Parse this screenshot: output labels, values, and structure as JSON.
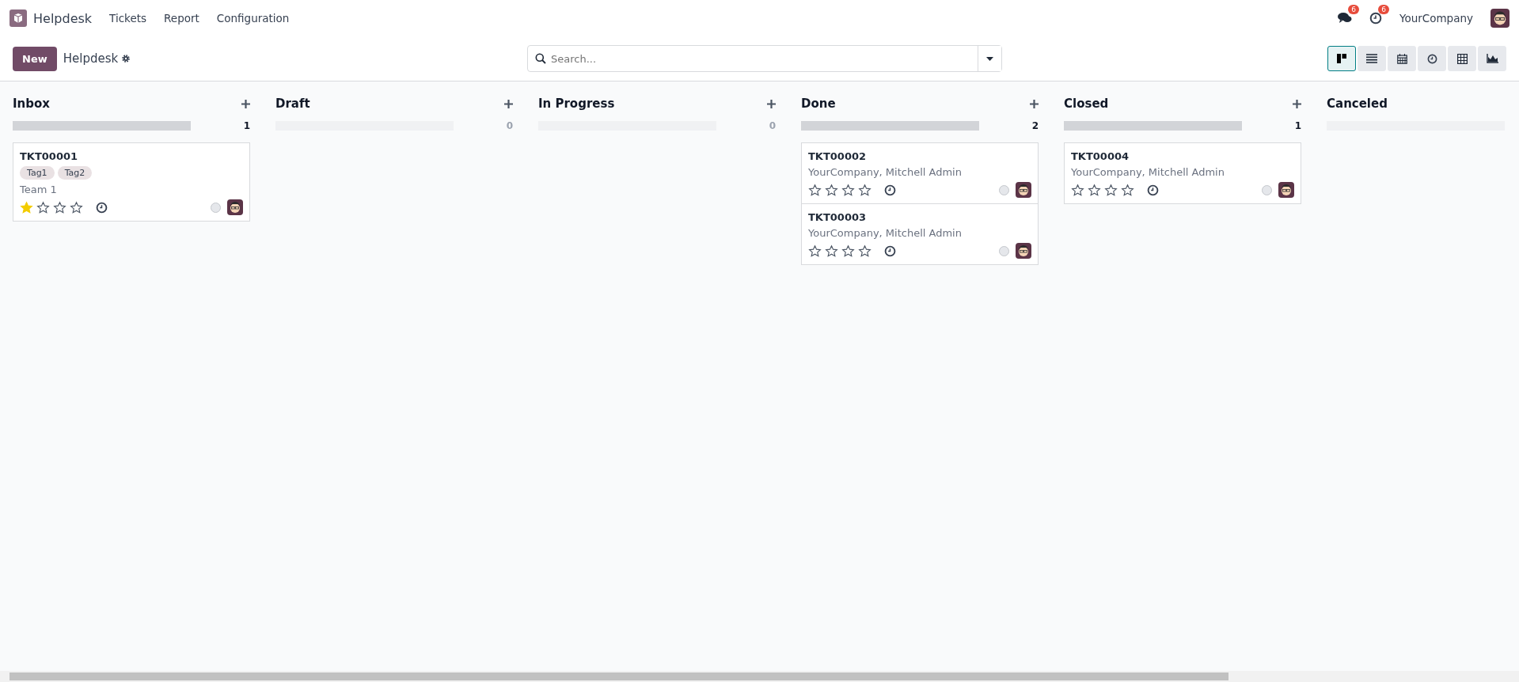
{
  "navbar": {
    "app_name": "Helpdesk",
    "menus": [
      "Tickets",
      "Report",
      "Configuration"
    ],
    "messages_badge": "6",
    "activities_badge": "6",
    "company": "YourCompany"
  },
  "control_panel": {
    "new_button": "New",
    "breadcrumb": "Helpdesk",
    "search": {
      "placeholder": "Search..."
    },
    "views": [
      {
        "kind": "kanban",
        "selected": true
      },
      {
        "kind": "list",
        "selected": false
      },
      {
        "kind": "calendar",
        "selected": false
      },
      {
        "kind": "activity",
        "selected": false
      },
      {
        "kind": "pivot",
        "selected": false
      },
      {
        "kind": "graph",
        "selected": false
      }
    ]
  },
  "columns": [
    {
      "title": "Inbox",
      "count": "1",
      "filled": true,
      "cards": [
        {
          "kind": "tags",
          "ref": "TKT00001",
          "tags": [
            "Tag1",
            "Tag2"
          ],
          "subtitle": "Team 1",
          "stars": 1
        }
      ]
    },
    {
      "title": "Draft",
      "count": "0",
      "filled": false
    },
    {
      "title": "In Progress",
      "count": "0",
      "filled": false
    },
    {
      "title": "Done",
      "count": "2",
      "filled": true,
      "cards": [
        {
          "kind": "partner",
          "ref": "TKT00002",
          "subtitle": "YourCompany, Mitchell Admin",
          "stars": 0
        },
        {
          "kind": "partner",
          "ref": "TKT00003",
          "subtitle": "YourCompany, Mitchell Admin",
          "stars": 0
        }
      ]
    },
    {
      "title": "Closed",
      "count": "1",
      "filled": true,
      "cards": [
        {
          "kind": "partner",
          "ref": "TKT00004",
          "subtitle": "YourCompany, Mitchell Admin",
          "stars": 0
        }
      ]
    },
    {
      "title": "Canceled",
      "filled": false
    }
  ]
}
